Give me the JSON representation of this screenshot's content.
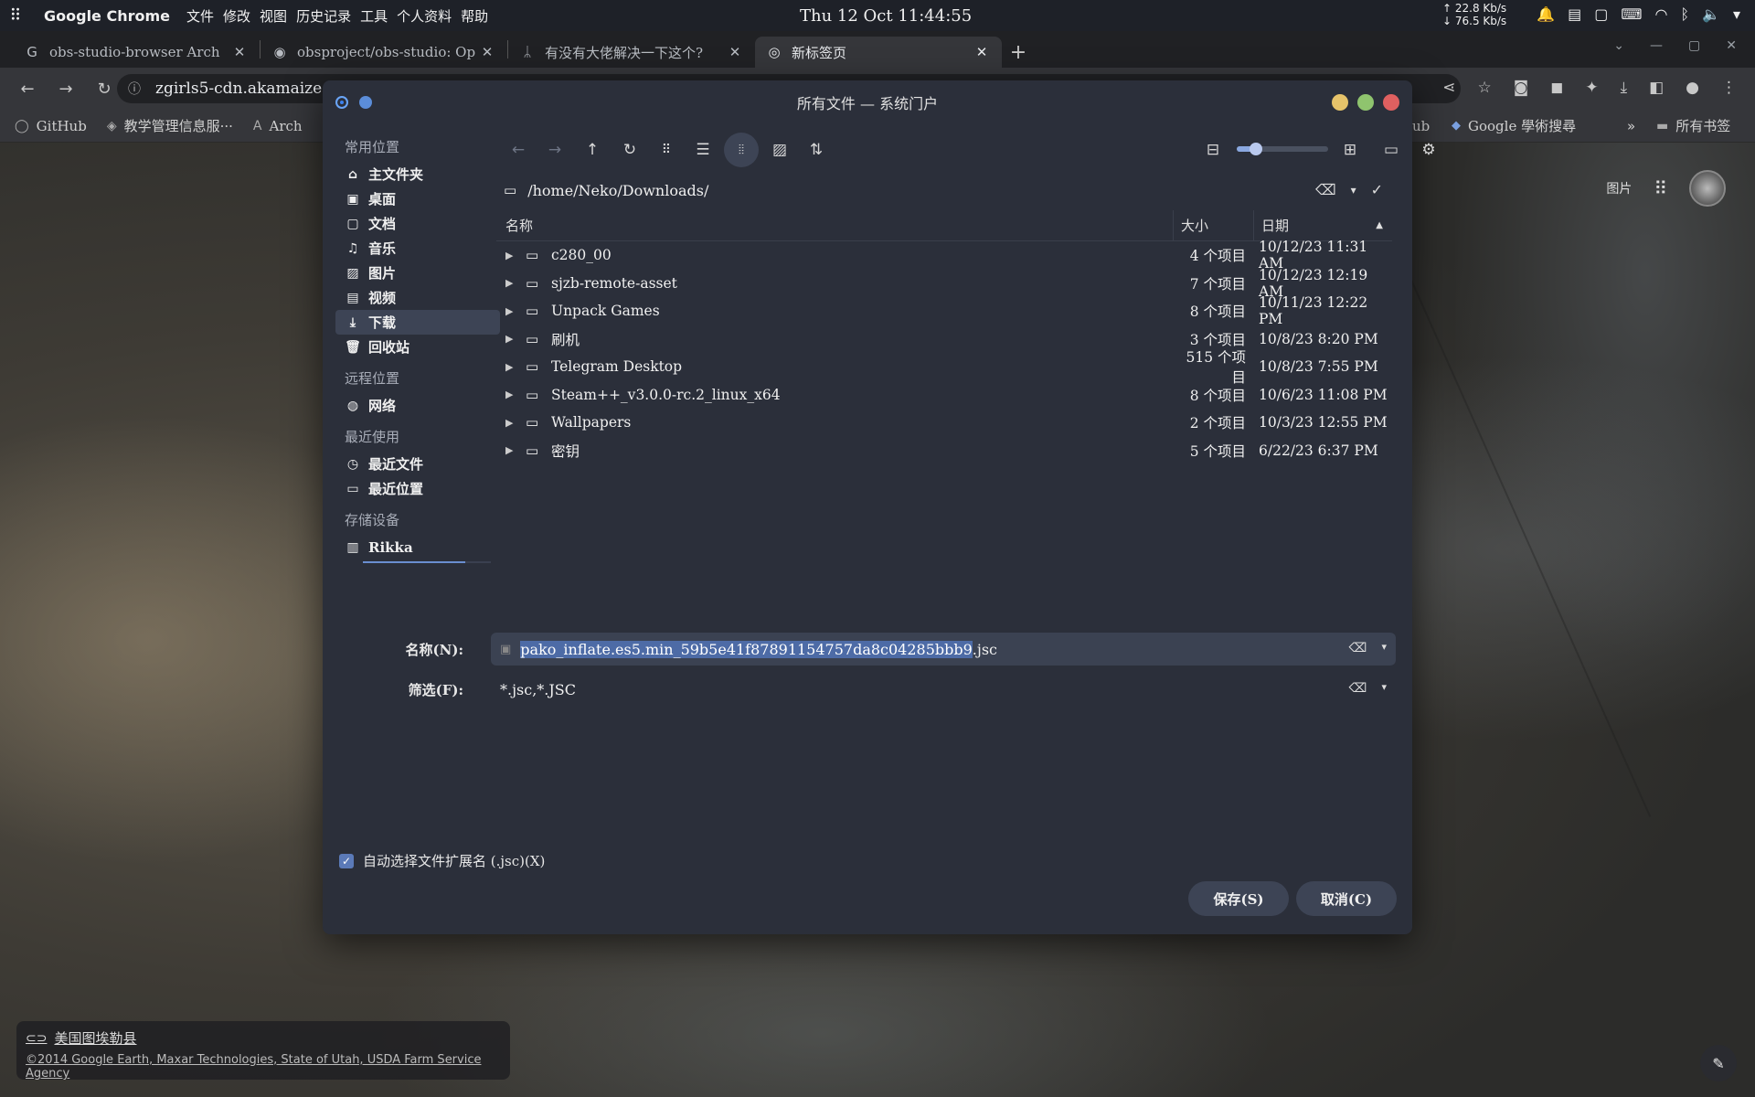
{
  "topbar": {
    "app_name": "Google Chrome",
    "menu": [
      "文件",
      "修改",
      "视图",
      "历史记录",
      "工具",
      "个人资料",
      "帮助"
    ],
    "clock": "Thu 12 Oct  11:44:55",
    "net_up": "↑ 22.8 Kb/s",
    "net_down": "↓ 76.5 Kb/s"
  },
  "tabs": [
    {
      "icon": "G",
      "title": "obs-studio-browser Arch"
    },
    {
      "icon": "◉",
      "title": "obsproject/obs-studio: Op"
    },
    {
      "icon": "ᛦ",
      "title": "有没有大佬解决一下这个?"
    },
    {
      "icon": "◎",
      "title": "新标签页"
    }
  ],
  "toolbar": {
    "url": "zgirls5-cdn.akamaized."
  },
  "bookmarks": {
    "items": [
      {
        "icon": "◯",
        "label": "GitHub"
      },
      {
        "icon": "◈",
        "label": "教学管理信息服···"
      },
      {
        "icon": "A",
        "label": "Arch"
      }
    ],
    "right_items": [
      {
        "icon": "",
        "label": "ub"
      },
      {
        "icon": "◆",
        "label": "Google 學術搜尋"
      }
    ],
    "more": "»",
    "all_bookmarks": "所有书签"
  },
  "ntp": {
    "images_link": "图片",
    "attribution_place": "美国图埃勒县",
    "attribution_credit": "©2014 Google Earth, Maxar Technologies, State of Utah, USDA Farm Service Agency"
  },
  "dialog": {
    "title": "所有文件 — 系统门户",
    "colors": {
      "yellow": "#e6c36a",
      "green": "#8fc46e",
      "red": "#e06060"
    },
    "places": {
      "section_common": "常用位置",
      "common": [
        {
          "icon": "⌂",
          "label": "主文件夹"
        },
        {
          "icon": "▣",
          "label": "桌面"
        },
        {
          "icon": "▢",
          "label": "文档"
        },
        {
          "icon": "♫",
          "label": "音乐"
        },
        {
          "icon": "▨",
          "label": "图片"
        },
        {
          "icon": "▤",
          "label": "视频"
        },
        {
          "icon": "⤓",
          "label": "下载"
        },
        {
          "icon": "🗑",
          "label": "回收站"
        }
      ],
      "section_remote": "远程位置",
      "remote": [
        {
          "icon": "◍",
          "label": "网络"
        }
      ],
      "section_recent": "最近使用",
      "recent": [
        {
          "icon": "◷",
          "label": "最近文件"
        },
        {
          "icon": "▭",
          "label": "最近位置"
        }
      ],
      "section_devices": "存储设备",
      "devices": [
        {
          "icon": "▥",
          "label": "Rikka"
        }
      ]
    },
    "path": "/home/Neko/Downloads/",
    "columns": {
      "name": "名称",
      "size": "大小",
      "date": "日期"
    },
    "files": [
      {
        "name": "c280_00",
        "size": "4 个项目",
        "date": "10/12/23 11:31 AM"
      },
      {
        "name": "sjzb-remote-asset",
        "size": "7 个项目",
        "date": "10/12/23 12:19 AM"
      },
      {
        "name": "Unpack Games",
        "size": "8 个项目",
        "date": "10/11/23 12:22 PM"
      },
      {
        "name": "刷机",
        "size": "3 个项目",
        "date": "10/8/23 8:20 PM"
      },
      {
        "name": "Telegram Desktop",
        "size": "515 个项目",
        "date": "10/8/23 7:55 PM"
      },
      {
        "name": "Steam++_v3.0.0-rc.2_linux_x64",
        "size": "8 个项目",
        "date": "10/6/23 11:08 PM"
      },
      {
        "name": "Wallpapers",
        "size": "2 个项目",
        "date": "10/3/23 12:55 PM"
      },
      {
        "name": "密钥",
        "size": "5 个项目",
        "date": "6/22/23 6:37 PM"
      }
    ],
    "name_label": "名称(N):",
    "filename_selected": "pako_inflate.es5.min_59b5e41f87891154757da8c04285bbb9",
    "filename_ext": ".jsc",
    "filter_label": "筛选(F):",
    "filter_value": "*.jsc,*.JSC",
    "auto_ext_label": "自动选择文件扩展名 (.jsc)(X)",
    "save_label": "保存(S)",
    "cancel_label": "取消(C)"
  }
}
